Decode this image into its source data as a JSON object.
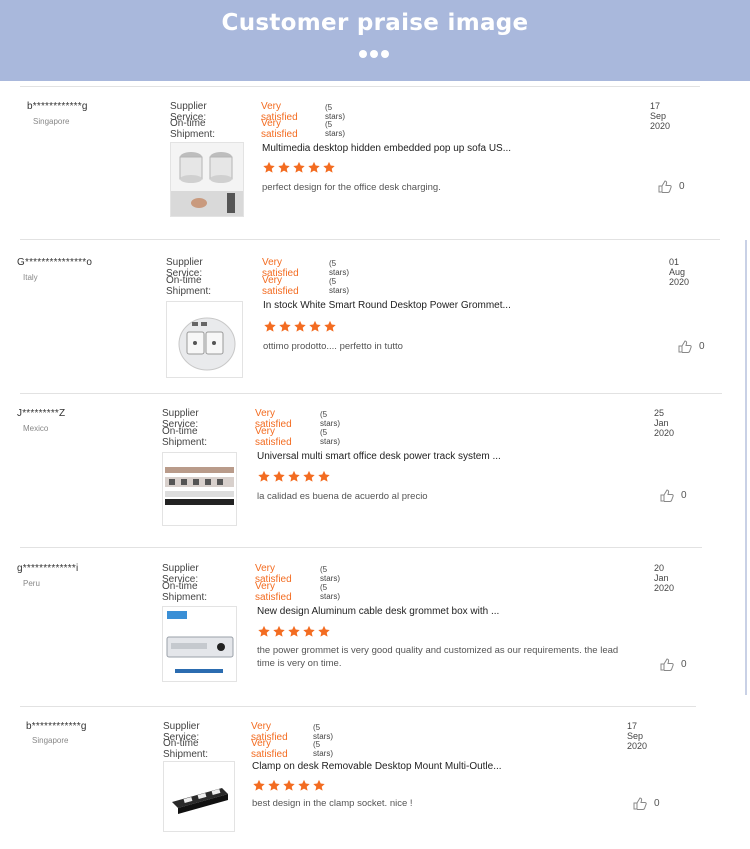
{
  "banner": {
    "title": "Customer praise image"
  },
  "reviews": [
    {
      "user": "b************g",
      "country": "Singapore",
      "supplier_label": "Supplier Service:",
      "supplier_value": "Very satisfied",
      "supplier_stars": "(5 stars)",
      "shipment_label": "On-time Shipment:",
      "shipment_value": "Very satisfied",
      "shipment_stars": "(5 stars)",
      "date": "17 Sep 2020",
      "product_title": "Multimedia desktop hidden embedded pop up sofa US...",
      "rating": 5,
      "comment": "perfect design for the office desk charging.",
      "likes": "0",
      "product_icon": "pop-up-socket-image"
    },
    {
      "user": "G***************o",
      "country": "Italy",
      "supplier_label": "Supplier Service:",
      "supplier_value": "Very satisfied",
      "supplier_stars": "(5 stars)",
      "shipment_label": "On-time Shipment:",
      "shipment_value": "Very satisfied",
      "shipment_stars": "(5 stars)",
      "date": "01 Aug 2020",
      "product_title": "In stock White Smart Round Desktop Power Grommet...",
      "rating": 5,
      "comment": "ottimo prodotto.... perfetto in tutto",
      "likes": "0",
      "product_icon": "round-grommet-image"
    },
    {
      "user": "J*********Z",
      "country": "Mexico",
      "supplier_label": "Supplier Service:",
      "supplier_value": "Very satisfied",
      "supplier_stars": "(5 stars)",
      "shipment_label": "On-time Shipment:",
      "shipment_value": "Very satisfied",
      "shipment_stars": "(5 stars)",
      "date": "25 Jan 2020",
      "product_title": "Universal multi smart office desk power track system ...",
      "rating": 5,
      "comment": "la  calidad es  buena  de acuerdo al  precio",
      "likes": "0",
      "product_icon": "power-track-image"
    },
    {
      "user": "g*************i",
      "country": "Peru",
      "supplier_label": "Supplier Service:",
      "supplier_value": "Very satisfied",
      "supplier_stars": "(5 stars)",
      "shipment_label": "On-time Shipment:",
      "shipment_value": "Very satisfied",
      "shipment_stars": "(5 stars)",
      "date": "20 Jan 2020",
      "product_title": "New design Aluminum cable desk grommet box with ...",
      "rating": 5,
      "comment": "the power grommet is very good quality and customized as our  requirements. the lead time is very on time.",
      "likes": "0",
      "product_icon": "grommet-box-image"
    },
    {
      "user": "b************g",
      "country": "Singapore",
      "supplier_label": "Supplier Service:",
      "supplier_value": "Very satisfied",
      "supplier_stars": "(5 stars)",
      "shipment_label": "On-time Shipment:",
      "shipment_value": "Very satisfied",
      "shipment_stars": "(5 stars)",
      "date": "17 Sep 2020",
      "product_title": "Clamp on desk Removable Desktop Mount Multi-Outle...",
      "rating": 5,
      "comment": "best design in the clamp socket. nice !",
      "likes": "0",
      "product_icon": "clamp-socket-image"
    }
  ],
  "colors": {
    "banner": "#a9b8dc",
    "accent": "#f36c21",
    "text": "#333333"
  }
}
